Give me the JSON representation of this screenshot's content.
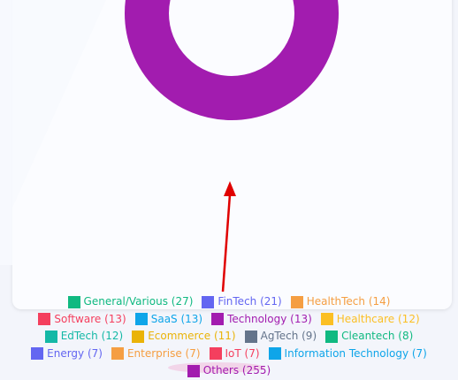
{
  "chart_data": {
    "type": "pie",
    "categories": [
      "General/Various",
      "FinTech",
      "HealthTech",
      "Software",
      "SaaS",
      "Technology",
      "Healthcare",
      "EdTech",
      "Ecommerce",
      "AgTech",
      "Cleantech",
      "Energy",
      "Enterprise",
      "IoT",
      "Information Technology",
      "Others"
    ],
    "values": [
      27,
      21,
      14,
      13,
      13,
      13,
      12,
      12,
      11,
      9,
      8,
      7,
      7,
      7,
      7,
      255
    ],
    "legend_placement": "bottom"
  },
  "legend": {
    "rows": [
      [
        {
          "label": "General/Various (27)",
          "color": "#10b981"
        },
        {
          "label": "FinTech (21)",
          "color": "#6366f1"
        },
        {
          "label": "HealthTech (14)",
          "color": "#f59e42"
        }
      ],
      [
        {
          "label": "Software (13)",
          "color": "#f43f5e"
        },
        {
          "label": "SaaS (13)",
          "color": "#0ea5e9"
        },
        {
          "label": "Technology (13)",
          "color": "#a21caf"
        },
        {
          "label": "Healthcare (12)",
          "color": "#fbbf24"
        }
      ],
      [
        {
          "label": "EdTech (12)",
          "color": "#14b8a6"
        },
        {
          "label": "Ecommerce (11)",
          "color": "#eab308"
        },
        {
          "label": "AgTech (9)",
          "color": "#64748b"
        },
        {
          "label": "Cleantech (8)",
          "color": "#10b981"
        }
      ],
      [
        {
          "label": "Energy (7)",
          "color": "#6366f1"
        },
        {
          "label": "Enterprise (7)",
          "color": "#f59e42"
        },
        {
          "label": "IoT (7)",
          "color": "#f43f5e"
        },
        {
          "label": "Information Technology (7)",
          "color": "#0ea5e9"
        }
      ],
      [
        {
          "label": "Others (255)",
          "color": "#a21caf"
        }
      ]
    ]
  },
  "colors": {
    "donut": "#a21caf",
    "arrow": "#e00000"
  }
}
